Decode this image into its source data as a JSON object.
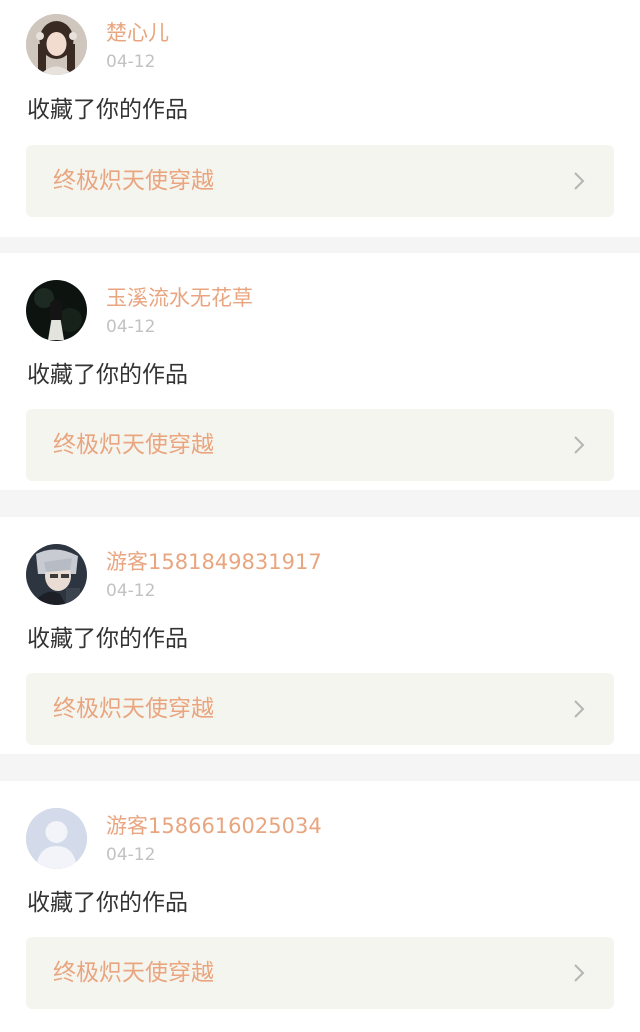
{
  "notifications": [
    {
      "username": "楚心儿",
      "date": "04-12",
      "action": "收藏了你的作品",
      "work_title": "终极炽天使穿越",
      "avatar_icon": "user-avatar-girl-photo"
    },
    {
      "username": "玉溪流水无花草",
      "date": "04-12",
      "action": "收藏了你的作品",
      "work_title": "终极炽天使穿越",
      "avatar_icon": "user-avatar-dark-figure"
    },
    {
      "username": "游客1581849831917",
      "date": "04-12",
      "action": "收藏了你的作品",
      "work_title": "终极炽天使穿越",
      "avatar_icon": "user-avatar-anime-boy"
    },
    {
      "username": "游客1586616025034",
      "date": "04-12",
      "action": "收藏了你的作品",
      "work_title": "终极炽天使穿越",
      "avatar_icon": "user-avatar-default-silhouette"
    }
  ],
  "colors": {
    "username": "#e9a57f",
    "work_title": "#e9a57f",
    "date": "#c2c2c2",
    "action_text": "#333333",
    "work_box_bg": "#f5f5ef",
    "separator": "#f5f5f5"
  }
}
